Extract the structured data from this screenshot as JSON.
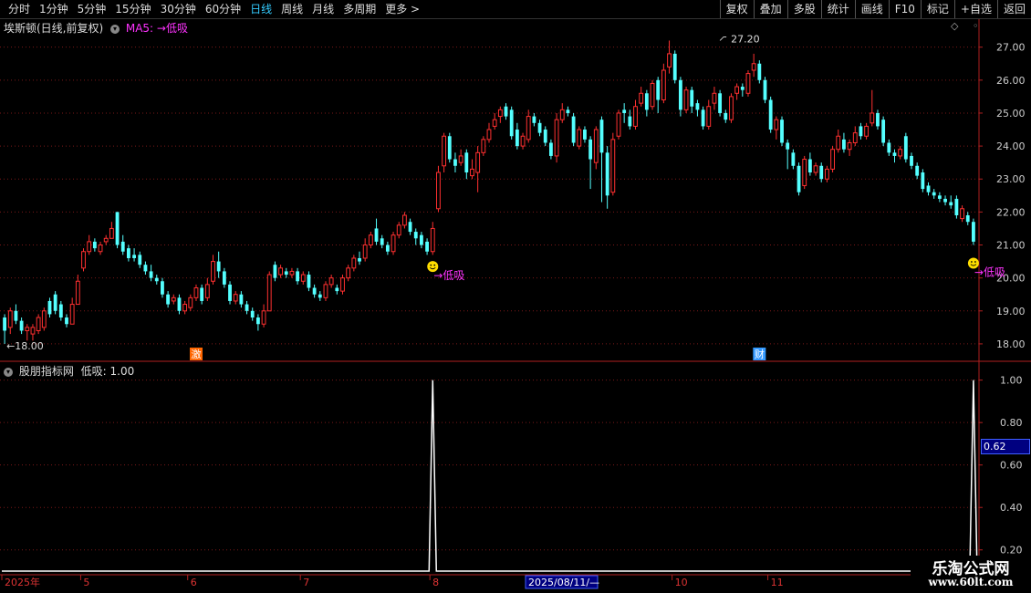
{
  "toolbar": {
    "periods": [
      "分时",
      "1分钟",
      "5分钟",
      "15分钟",
      "30分钟",
      "60分钟",
      "日线",
      "周线",
      "月线",
      "多周期",
      "更多 >"
    ],
    "active_period": "日线",
    "right_buttons": [
      "复权",
      "叠加",
      "多股",
      "统计",
      "画线",
      "F10",
      "标记",
      "+自选",
      "返回"
    ]
  },
  "main_panel": {
    "title": "埃斯顿(日线,前复权)",
    "ma_label": "MA5:",
    "ma_value": "→低吸",
    "corner_icons": [
      "diamond-icon",
      "settings-icon"
    ]
  },
  "sub_panel": {
    "title": "股朋指标网",
    "indicator_label": "低吸: 1.00",
    "cursor_value": "0.62"
  },
  "chart_data": [
    {
      "type": "candlestick",
      "ylim": [
        17.5,
        27.6
      ],
      "y_ticks": [
        18.0,
        19.0,
        20.0,
        21.0,
        22.0,
        23.0,
        24.0,
        25.0,
        26.0,
        27.0
      ],
      "y_tick_labels": [
        "18.00",
        "19.00",
        "20.00",
        "21.00",
        "22.00",
        "23.00",
        "24.00",
        "25.00",
        "26.00",
        "27.00"
      ],
      "grid": true,
      "colors": {
        "up": "#ff3030",
        "down": "#54ffff",
        "grid": "#7a1818",
        "axis": "#b02020"
      },
      "ohlc": [
        [
          18.8,
          18.4,
          18.9,
          18.0
        ],
        [
          18.5,
          19.0,
          19.1,
          18.3
        ],
        [
          19.0,
          18.7,
          19.2,
          18.6
        ],
        [
          18.7,
          18.4,
          18.8,
          18.3
        ],
        [
          18.4,
          18.5,
          18.6,
          18.1
        ],
        [
          18.3,
          18.5,
          18.6,
          18.1
        ],
        [
          18.4,
          18.8,
          18.9,
          18.3
        ],
        [
          18.5,
          19.0,
          19.1,
          18.4
        ],
        [
          19.3,
          18.9,
          19.4,
          18.8
        ],
        [
          19.5,
          19.0,
          19.6,
          18.9
        ],
        [
          19.2,
          18.8,
          19.3,
          18.7
        ],
        [
          18.8,
          18.6,
          18.9,
          18.5
        ],
        [
          18.6,
          19.2,
          19.4,
          18.6
        ],
        [
          19.2,
          19.9,
          20.1,
          19.2
        ],
        [
          20.3,
          20.8,
          20.9,
          20.2
        ],
        [
          20.8,
          21.1,
          21.3,
          20.7
        ],
        [
          21.1,
          20.9,
          21.2,
          20.8
        ],
        [
          20.8,
          21.0,
          21.1,
          20.7
        ],
        [
          21.1,
          21.2,
          21.3,
          21.0
        ],
        [
          21.2,
          21.5,
          21.7,
          21.2
        ],
        [
          22.0,
          21.0,
          22.0,
          20.9
        ],
        [
          21.1,
          20.8,
          21.3,
          20.7
        ],
        [
          20.9,
          20.6,
          21.0,
          20.5
        ],
        [
          20.7,
          20.6,
          20.9,
          20.5
        ],
        [
          20.7,
          20.4,
          20.8,
          20.3
        ],
        [
          20.4,
          20.2,
          20.5,
          20.1
        ],
        [
          20.2,
          20.0,
          20.4,
          19.9
        ],
        [
          20.0,
          19.9,
          20.1,
          19.8
        ],
        [
          19.9,
          19.5,
          20.0,
          19.4
        ],
        [
          19.5,
          19.2,
          19.6,
          19.1
        ],
        [
          19.3,
          19.4,
          19.5,
          19.2
        ],
        [
          19.4,
          19.0,
          19.5,
          18.9
        ],
        [
          19.0,
          19.2,
          19.3,
          18.9
        ],
        [
          19.1,
          19.4,
          19.5,
          19.0
        ],
        [
          19.4,
          19.7,
          19.8,
          19.3
        ],
        [
          19.7,
          19.3,
          19.8,
          19.2
        ],
        [
          19.4,
          19.8,
          20.0,
          19.3
        ],
        [
          19.9,
          20.5,
          20.7,
          19.8
        ],
        [
          20.5,
          20.2,
          20.8,
          20.0
        ],
        [
          20.2,
          19.8,
          20.3,
          19.7
        ],
        [
          19.8,
          19.3,
          19.9,
          19.2
        ],
        [
          19.3,
          19.5,
          19.6,
          19.2
        ],
        [
          19.5,
          19.2,
          19.6,
          19.1
        ],
        [
          19.2,
          19.0,
          19.3,
          18.9
        ],
        [
          19.0,
          18.8,
          19.1,
          18.7
        ],
        [
          18.8,
          18.6,
          18.9,
          18.4
        ],
        [
          18.6,
          19.0,
          19.2,
          18.5
        ],
        [
          19.0,
          20.1,
          20.2,
          19.0
        ],
        [
          20.4,
          20.0,
          20.5,
          19.9
        ],
        [
          20.1,
          20.3,
          20.4,
          20.0
        ],
        [
          20.2,
          20.1,
          20.3,
          20.0
        ],
        [
          20.1,
          20.2,
          20.3,
          20.0
        ],
        [
          20.2,
          19.9,
          20.3,
          19.8
        ],
        [
          19.9,
          20.1,
          20.2,
          19.8
        ],
        [
          20.1,
          19.7,
          20.2,
          19.6
        ],
        [
          19.7,
          19.5,
          19.8,
          19.4
        ],
        [
          19.5,
          19.4,
          19.6,
          19.3
        ],
        [
          19.4,
          19.8,
          19.9,
          19.3
        ],
        [
          19.8,
          20.0,
          20.1,
          19.7
        ],
        [
          19.7,
          19.6,
          19.8,
          19.5
        ],
        [
          19.6,
          20.0,
          20.1,
          19.5
        ],
        [
          20.0,
          20.3,
          20.4,
          19.9
        ],
        [
          20.3,
          20.6,
          20.7,
          20.2
        ],
        [
          20.6,
          20.5,
          20.8,
          20.4
        ],
        [
          20.6,
          21.0,
          21.2,
          20.5
        ],
        [
          21.0,
          21.3,
          21.4,
          20.9
        ],
        [
          21.5,
          21.1,
          21.8,
          21.0
        ],
        [
          21.2,
          21.0,
          21.3,
          20.9
        ],
        [
          21.0,
          20.8,
          21.1,
          20.7
        ],
        [
          20.8,
          21.3,
          21.4,
          20.7
        ],
        [
          21.3,
          21.6,
          21.7,
          21.2
        ],
        [
          21.6,
          21.9,
          22.0,
          21.5
        ],
        [
          21.7,
          21.4,
          21.8,
          21.3
        ],
        [
          21.4,
          21.2,
          21.5,
          21.0
        ],
        [
          21.3,
          21.0,
          21.4,
          20.9
        ],
        [
          21.1,
          20.8,
          21.2,
          20.7
        ],
        [
          20.8,
          21.5,
          21.7,
          20.7
        ],
        [
          22.1,
          23.2,
          23.4,
          22.0
        ],
        [
          23.4,
          24.3,
          24.4,
          23.2
        ],
        [
          24.3,
          23.6,
          24.4,
          23.5
        ],
        [
          23.6,
          23.4,
          23.8,
          23.2
        ],
        [
          23.5,
          23.7,
          23.9,
          23.4
        ],
        [
          23.8,
          23.2,
          23.9,
          23.0
        ],
        [
          23.1,
          23.3,
          23.6,
          23.0
        ],
        [
          23.2,
          23.8,
          24.0,
          22.6
        ],
        [
          23.8,
          24.2,
          24.3,
          23.7
        ],
        [
          24.2,
          24.5,
          24.7,
          24.1
        ],
        [
          24.6,
          24.8,
          25.0,
          24.5
        ],
        [
          24.9,
          25.1,
          25.2,
          24.7
        ],
        [
          25.2,
          24.9,
          25.3,
          24.8
        ],
        [
          25.1,
          24.3,
          25.2,
          24.2
        ],
        [
          24.5,
          24.0,
          24.7,
          23.9
        ],
        [
          24.0,
          24.3,
          24.4,
          23.9
        ],
        [
          24.2,
          24.9,
          25.1,
          24.1
        ],
        [
          24.9,
          24.7,
          25.0,
          24.6
        ],
        [
          24.7,
          24.4,
          24.8,
          24.3
        ],
        [
          24.5,
          24.1,
          24.6,
          24.0
        ],
        [
          24.1,
          23.7,
          24.2,
          23.6
        ],
        [
          23.7,
          24.8,
          25.0,
          23.5
        ],
        [
          24.8,
          25.1,
          25.3,
          24.7
        ],
        [
          25.1,
          25.0,
          25.2,
          24.9
        ],
        [
          24.9,
          24.1,
          25.0,
          24.0
        ],
        [
          24.0,
          24.5,
          24.6,
          23.9
        ],
        [
          24.5,
          24.2,
          24.6,
          24.1
        ],
        [
          24.2,
          23.6,
          24.3,
          22.7
        ],
        [
          23.5,
          24.5,
          24.6,
          23.3
        ],
        [
          24.8,
          23.8,
          24.9,
          22.3
        ],
        [
          23.8,
          22.5,
          24.0,
          22.1
        ],
        [
          22.6,
          24.2,
          24.4,
          22.5
        ],
        [
          24.3,
          25.0,
          25.1,
          24.2
        ],
        [
          25.1,
          25.0,
          25.3,
          24.7
        ],
        [
          24.9,
          24.6,
          25.1,
          24.5
        ],
        [
          24.6,
          25.2,
          25.4,
          24.5
        ],
        [
          25.3,
          25.6,
          25.8,
          25.2
        ],
        [
          25.6,
          25.1,
          25.7,
          24.9
        ],
        [
          25.2,
          25.9,
          26.0,
          25.1
        ],
        [
          26.0,
          25.4,
          26.1,
          25.0
        ],
        [
          25.4,
          26.3,
          26.5,
          25.3
        ],
        [
          26.4,
          26.8,
          27.2,
          26.2
        ],
        [
          26.8,
          26.0,
          26.9,
          25.9
        ],
        [
          26.0,
          25.1,
          26.1,
          24.9
        ],
        [
          25.1,
          25.7,
          25.8,
          25.0
        ],
        [
          25.7,
          25.2,
          25.8,
          25.0
        ],
        [
          25.3,
          25.1,
          25.4,
          24.9
        ],
        [
          25.1,
          24.6,
          25.2,
          24.5
        ],
        [
          24.6,
          25.2,
          25.4,
          24.5
        ],
        [
          25.3,
          25.6,
          25.8,
          25.1
        ],
        [
          25.6,
          25.0,
          25.7,
          24.9
        ],
        [
          25.0,
          24.8,
          25.1,
          24.7
        ],
        [
          24.8,
          25.5,
          25.6,
          24.7
        ],
        [
          25.6,
          25.8,
          25.9,
          25.4
        ],
        [
          25.8,
          25.7,
          25.9,
          25.5
        ],
        [
          25.6,
          26.2,
          26.3,
          25.5
        ],
        [
          26.3,
          26.5,
          26.8,
          26.1
        ],
        [
          26.5,
          26.0,
          26.6,
          25.9
        ],
        [
          26.0,
          25.4,
          26.1,
          25.3
        ],
        [
          25.4,
          24.5,
          25.5,
          24.4
        ],
        [
          24.5,
          24.8,
          24.9,
          24.2
        ],
        [
          24.8,
          24.1,
          24.9,
          24.0
        ],
        [
          24.1,
          23.9,
          24.2,
          23.3
        ],
        [
          23.8,
          23.4,
          23.9,
          23.3
        ],
        [
          23.4,
          22.6,
          23.5,
          22.5
        ],
        [
          22.8,
          23.6,
          23.7,
          22.7
        ],
        [
          23.6,
          23.2,
          23.8,
          23.1
        ],
        [
          23.2,
          23.4,
          23.5,
          23.1
        ],
        [
          23.4,
          23.0,
          23.5,
          22.9
        ],
        [
          23.0,
          23.3,
          23.4,
          22.9
        ],
        [
          23.3,
          23.9,
          24.0,
          23.2
        ],
        [
          23.9,
          24.3,
          24.5,
          23.8
        ],
        [
          24.2,
          23.9,
          24.4,
          23.8
        ],
        [
          23.9,
          24.1,
          24.2,
          23.7
        ],
        [
          24.1,
          24.4,
          24.6,
          24.0
        ],
        [
          24.6,
          24.3,
          24.7,
          24.2
        ],
        [
          24.3,
          24.6,
          24.7,
          24.2
        ],
        [
          24.7,
          25.0,
          25.7,
          24.6
        ],
        [
          25.0,
          24.6,
          25.1,
          24.5
        ],
        [
          24.8,
          24.1,
          24.9,
          24.0
        ],
        [
          24.1,
          23.8,
          24.2,
          23.7
        ],
        [
          23.8,
          23.7,
          23.9,
          23.5
        ],
        [
          23.7,
          23.9,
          24.0,
          23.6
        ],
        [
          24.3,
          23.6,
          24.4,
          23.5
        ],
        [
          23.7,
          23.4,
          23.8,
          23.3
        ],
        [
          23.4,
          23.1,
          23.5,
          23.0
        ],
        [
          23.2,
          22.7,
          23.3,
          22.6
        ],
        [
          22.8,
          22.6,
          22.9,
          22.5
        ],
        [
          22.6,
          22.5,
          22.7,
          22.4
        ],
        [
          22.5,
          22.4,
          22.6,
          22.3
        ],
        [
          22.4,
          22.3,
          22.5,
          22.2
        ],
        [
          22.3,
          22.2,
          22.5,
          22.1
        ],
        [
          22.4,
          21.9,
          22.5,
          21.8
        ],
        [
          21.8,
          22.1,
          22.2,
          21.7
        ],
        [
          21.9,
          21.7,
          22.0,
          21.6
        ],
        [
          21.7,
          21.1,
          21.8,
          21.0
        ]
      ],
      "annotations": [
        {
          "text": "27.20",
          "x_index": 127,
          "y": 27.2,
          "label": "high"
        },
        {
          "text": "18.00",
          "x_index": 0,
          "y": 18.0,
          "label": "low"
        },
        {
          "text": "→低吸",
          "x_index": 76,
          "y": 20.9,
          "color": "#ff33ff",
          "marker": "smiley-icon"
        },
        {
          "text": "→低吸",
          "x_index": 172,
          "y": 21.0,
          "color": "#ff33ff",
          "marker": "smiley-icon"
        }
      ],
      "markers": [
        {
          "text": "激",
          "x_index": 34,
          "color": "#ff6600"
        },
        {
          "text": "财",
          "x_index": 134,
          "color": "#3399ff"
        }
      ]
    },
    {
      "type": "line",
      "title": "低吸",
      "ylim": [
        0.1,
        1.05
      ],
      "y_ticks": [
        0.2,
        0.4,
        0.6,
        0.8,
        1.0
      ],
      "y_tick_labels": [
        "0.20",
        "0.40",
        "0.60",
        "0.80",
        "1.00"
      ],
      "spikes": [
        {
          "x_index": 76,
          "value": 1.0
        },
        {
          "x_index": 172,
          "value": 1.0
        }
      ],
      "baseline": 0.0
    }
  ],
  "x_axis": {
    "labels": [
      {
        "text": "2025年",
        "x_index": 0
      },
      {
        "text": "5",
        "x_index": 14
      },
      {
        "text": "6",
        "x_index": 33
      },
      {
        "text": "7",
        "x_index": 53
      },
      {
        "text": "8",
        "x_index": 76
      },
      {
        "text": "9",
        "x_index": 97
      },
      {
        "text": "10",
        "x_index": 119
      },
      {
        "text": "11",
        "x_index": 136
      }
    ],
    "cursor_date": "2025/08/11/—"
  },
  "watermark": {
    "line1": "乐淘公式网",
    "line2": "www.60lt.com"
  }
}
